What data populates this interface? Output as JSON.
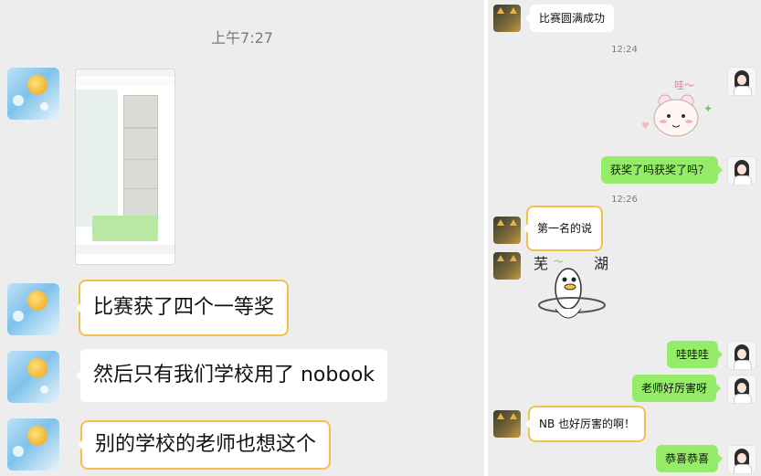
{
  "left": {
    "timestamp": "上午7:27",
    "messages": [
      {
        "text": "比赛获了四个一等奖"
      },
      {
        "text": "然后只有我们学校用了 nobook"
      },
      {
        "text": "别的学校的老师也想这个"
      }
    ]
  },
  "right": {
    "messages": [
      {
        "text": "比赛圆满成功"
      },
      {
        "text": "获奖了吗获奖了吗？"
      },
      {
        "text": "第一名的说"
      },
      {
        "text": "哇哇哇"
      },
      {
        "text": "老师好厉害呀"
      },
      {
        "text": "NB 也好厉害的啊！"
      },
      {
        "text": "恭喜恭喜"
      }
    ],
    "time_1": "12:24",
    "time_2": "12:26",
    "sticker_bear_text": "哇～",
    "sticker_duck_text_left": "芜",
    "sticker_duck_text_right": "湖"
  },
  "colors": {
    "panel_bg": "#ededed",
    "bubble_in": "#ffffff",
    "bubble_out": "#95ec69",
    "highlight": "#f2c14a"
  }
}
